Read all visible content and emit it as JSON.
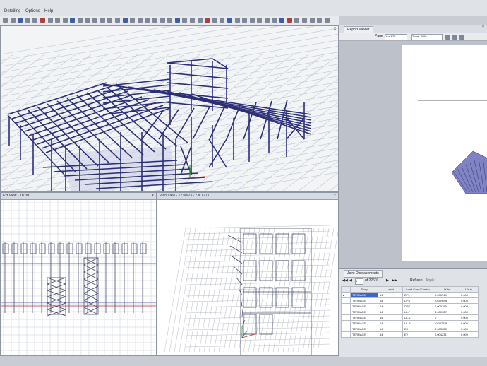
{
  "menu": [
    "Detailing",
    "Options",
    "Help"
  ],
  "view_3d": {
    "close": "x"
  },
  "elevation_view": {
    "title": "Ext View - 1B.3B",
    "close": "x"
  },
  "plan_view": {
    "title": "Plan View - 12.00/23 - Z = 12.00",
    "close": "x"
  },
  "report_viewer": {
    "tab": "Report Viewer",
    "close": "x",
    "page_label": "Page",
    "page_value": "1 of 625",
    "zoom_label": "Zoom: 98%"
  },
  "joint_displacements": {
    "tab": "Joint Displacements",
    "page_field": "1",
    "page_of": "of 22603",
    "refresh": "Refresh",
    "apply": "Apply",
    "headers": [
      "",
      "Story",
      "Label",
      "Load Case/Combo",
      "UX in",
      "UY in"
    ],
    "rows": [
      [
        "▸",
        "TERRACE",
        "14",
        "DPL",
        "0.000744",
        "0.000"
      ],
      [
        "",
        "TERRACE",
        "14",
        "DPS",
        "-0.009998",
        "0.000"
      ],
      [
        "",
        "TERRACE",
        "14",
        "DPS",
        "0.000765",
        "0.000"
      ],
      [
        "",
        "TERRACE",
        "14",
        "LL-F",
        "0.000927",
        "0.000"
      ],
      [
        "",
        "TERRACE",
        "14",
        "LL-S",
        "0",
        "0.000"
      ],
      [
        "",
        "TERRACE",
        "14",
        "LL-R",
        "-0.002799",
        "0.000"
      ],
      [
        "",
        "TERRACE",
        "14",
        "EX",
        "0.003023",
        "0.000"
      ],
      [
        "",
        "TERRACE",
        "14",
        "EY",
        "0.004231",
        "0.000"
      ]
    ]
  }
}
